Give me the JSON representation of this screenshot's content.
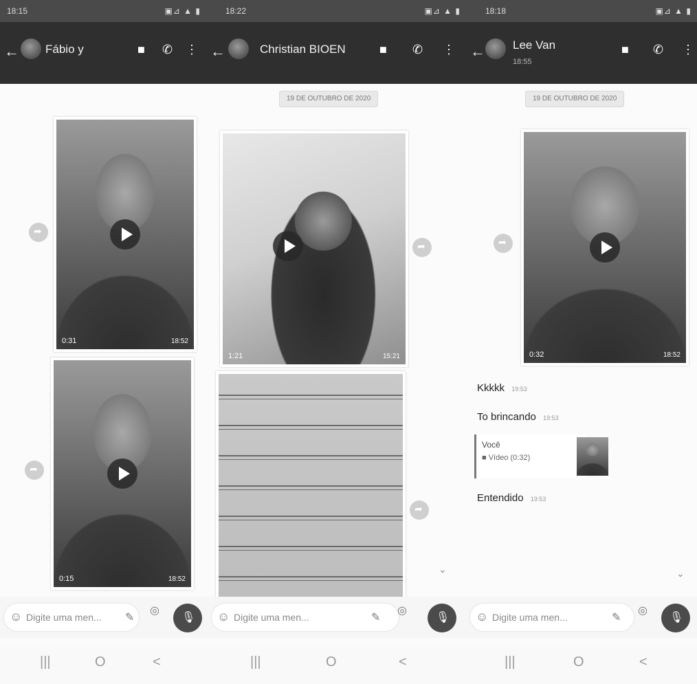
{
  "panels": [
    {
      "status_time": "18:15",
      "status_net": "▣⊿ ▲ ▮",
      "contact": "Fábio y",
      "header_sub": "",
      "date_chip": "",
      "videos": [
        {
          "duration": "0:31",
          "time": "18:52"
        },
        {
          "duration": "0:15",
          "time": "18:52"
        }
      ],
      "input_placeholder": "Digite uma men...",
      "icons": {
        "back": "back-arrow-icon",
        "video": "video-call-icon",
        "phone": "phone-icon",
        "menu": "more-vert-icon"
      }
    },
    {
      "status_time": "18:22",
      "status_net": "▣⊿ ▲ ▮",
      "contact": "Christian BIOEN",
      "header_sub": "",
      "date_chip": "19 DE OUTUBRO DE 2020",
      "videos": [
        {
          "duration": "1:21",
          "time": "15:21"
        }
      ],
      "input_placeholder": "Digite uma men..."
    },
    {
      "status_time": "18:18",
      "status_net": "▣⊿ ▲ ▮",
      "contact": "Lee Van",
      "header_sub": "18:55",
      "date_chip": "19 DE OUTUBRO DE 2020",
      "videos": [
        {
          "duration": "0:32",
          "time": "18:52"
        }
      ],
      "messages": [
        {
          "text": "Kkkkk",
          "time": "19:53"
        },
        {
          "text": "To brincando",
          "time": "19:53"
        },
        {
          "text": "Entendido",
          "time": "19:53"
        }
      ],
      "reply": {
        "author": "Você",
        "text": "■ Vídeo (0:32)"
      },
      "input_placeholder": "Digite uma men..."
    }
  ],
  "nav": {
    "recent": "|||",
    "home": "O",
    "back": "<"
  },
  "colors": {
    "header": "#2f2f2f",
    "statusbar": "#4a4a4a",
    "mic": "#4b4b4b"
  }
}
